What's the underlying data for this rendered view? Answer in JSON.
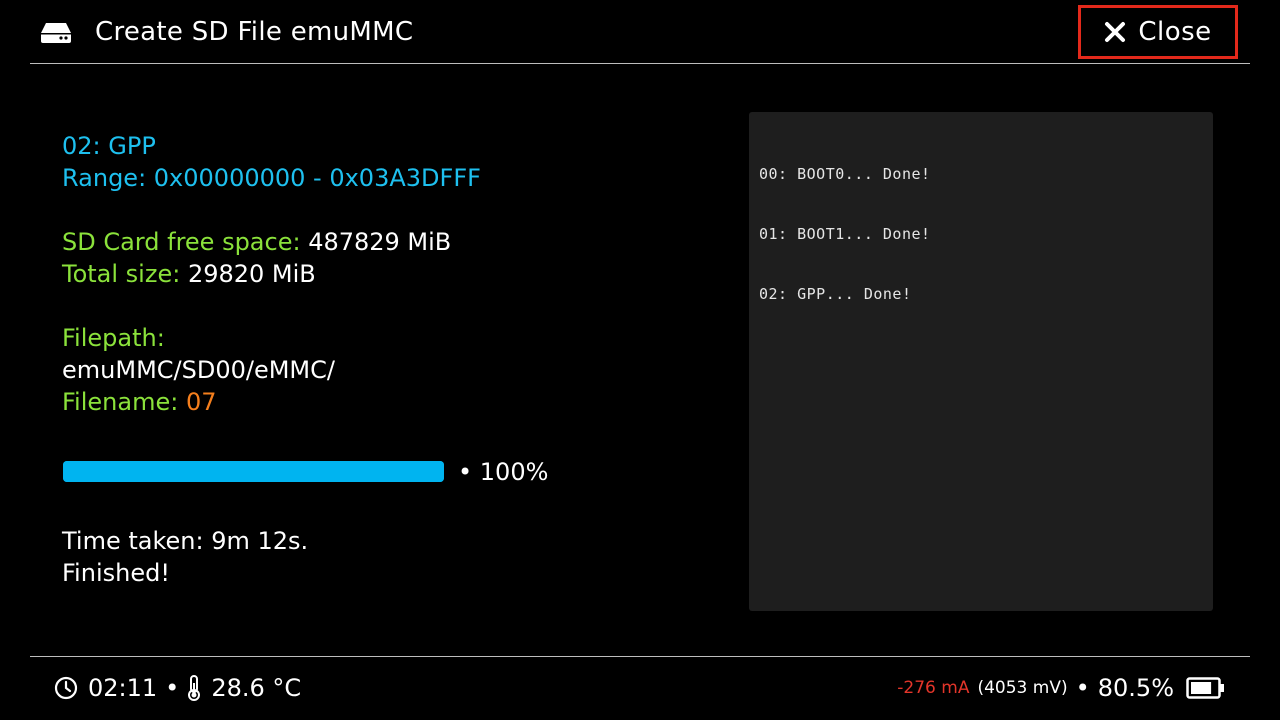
{
  "header": {
    "title": "Create SD File emuMMC",
    "close_label": "Close",
    "icon": "drive-icon"
  },
  "info": {
    "partition": "02: GPP",
    "range": "Range: 0x00000000 - 0x03A3DFFF",
    "free_space_label": "SD Card free space: ",
    "free_space_value": "487829 MiB",
    "total_size_label": "Total size: ",
    "total_size_value": "29820 MiB",
    "filepath_label": "Filepath:",
    "filepath_value": "emuMMC/SD00/eMMC/",
    "filename_label": "Filename: ",
    "filename_value": "07",
    "time_taken": "Time taken: 9m 12s.",
    "status": "Finished!"
  },
  "progress": {
    "fraction": 1.0,
    "label": "• 100%"
  },
  "log": {
    "lines": [
      "00: BOOT0... Done!",
      "01: BOOT1... Done!",
      "02: GPP... Done!"
    ]
  },
  "footer": {
    "time": "02:11",
    "separator": "•",
    "temperature": "28.6 °C",
    "current": "-276 mA",
    "voltage": "(4053 mV)",
    "battery_percent": "80.5%",
    "battery_level": 0.805
  },
  "colors": {
    "accent_cyan": "#1ec0ef",
    "label_green": "#8be23b",
    "value_orange": "#f57f1d",
    "progress_blue": "#00b4f0",
    "close_border_red": "#e3291b",
    "current_red": "#e3352a",
    "log_panel_bg": "#1e1e1e"
  }
}
